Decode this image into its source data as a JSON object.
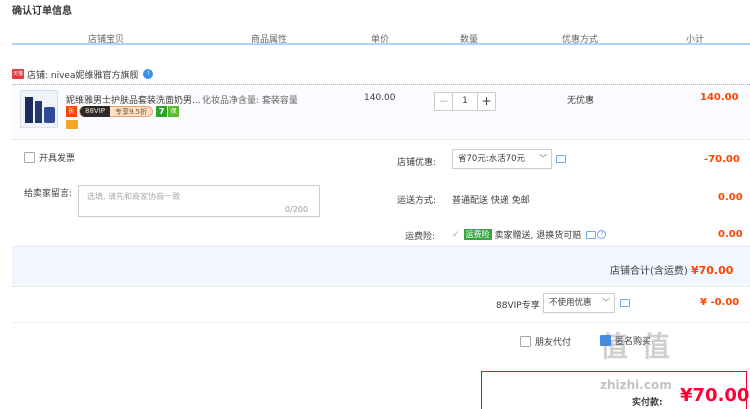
{
  "page_title": "确认订单信息",
  "columns": [
    "店铺宝贝",
    "商品属性",
    "单价",
    "数量",
    "优惠方式",
    "小计"
  ],
  "shop": {
    "icon_text": "天猫",
    "name": "店铺: nivea妮维雅官方旗舰",
    "badge": "!"
  },
  "item": {
    "name": "妮维雅男士护肤品套装洗面奶男...",
    "attribute": "化妆品净含量: 套装容量",
    "tag_vip_a": "88VIP",
    "tag_vip_b": "专享9.5折",
    "tag_seven": "7",
    "unit_price": "140.00",
    "quantity": "1",
    "minus": "−",
    "plus": "+",
    "discount": "无优惠",
    "subtotal": "140.00"
  },
  "invoice_label": "开具发票",
  "message": {
    "label": "给卖家留言:",
    "placeholder": "选填, 请先和商家协商一致",
    "count": "0/200"
  },
  "shop_discount": {
    "label": "店铺优惠:",
    "selected": "省70元:水活70元",
    "value": "-70.00"
  },
  "shipping": {
    "label": "运送方式:",
    "method": "普通配送 快递 免邮",
    "value": "0.00"
  },
  "insurance": {
    "label": "运费险:",
    "badge": "运费险",
    "text": "卖家赠送, 退换货可赔",
    "value": "0.00"
  },
  "shop_total": {
    "label": "店铺合计(含运费)",
    "value": "¥70.00"
  },
  "vip": {
    "label": "88VIP专享",
    "selected": "不使用优惠",
    "value": "¥ -0.00"
  },
  "friend_pay": "朋友代付",
  "anonymous": "匿名购买",
  "pay": {
    "label": "实付款:",
    "value": "¥70.00"
  },
  "watermark": "值 值",
  "watermark_url": "zhizhi.com",
  "colors": {
    "accent_red": "#ff4400",
    "header_line": "#b2d1ff",
    "primary_blue": "#3b8ff1"
  }
}
